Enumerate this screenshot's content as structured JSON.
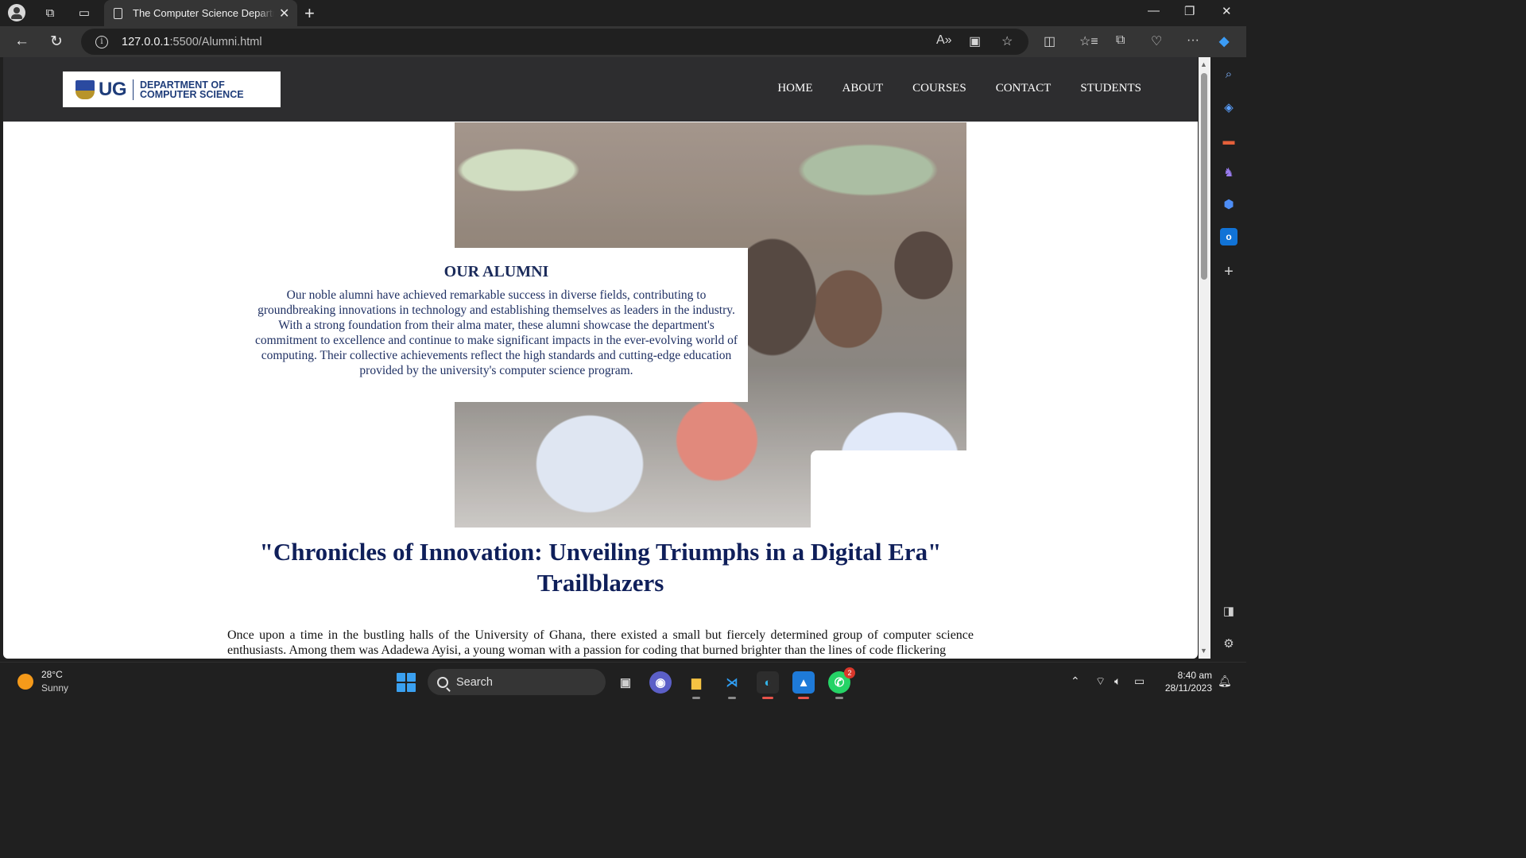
{
  "browser": {
    "tab_title": "The Computer Science Departme",
    "url_host": "127.0.0.1",
    "url_path": ":5500/Alumni.html",
    "new_tab": "+",
    "tab_close": "✕"
  },
  "site": {
    "logo": {
      "ug": "UG",
      "dept_line1": "DEPARTMENT OF",
      "dept_line2": "COMPUTER SCIENCE"
    },
    "nav": [
      "HOME",
      "ABOUT",
      "COURSES",
      "CONTACT",
      "STUDENTS"
    ],
    "alumni": {
      "title": "OUR ALUMNI",
      "text": "Our noble alumni have achieved remarkable success in diverse fields, contributing to groundbreaking innovations in technology and establishing themselves as leaders in the industry. With a strong foundation from their alma mater, these alumni showcase the department's commitment to excellence and continue to make significant impacts in the ever-evolving world of computing. Their collective achievements reflect the high standards and cutting-edge education provided by the university's computer science program."
    },
    "heading_line1": "\"Chronicles of Innovation: Unveiling Triumphs in a Digital Era\"",
    "heading_line2": "Trailblazers",
    "story": "Once upon a time in the bustling halls of the University of Ghana, there existed a small but fiercely determined group of computer science enthusiasts. Among them was Adadewa Ayisi, a young woman with a passion for coding that burned brighter than the lines of code flickering"
  },
  "taskbar": {
    "weather_temp": "28°C",
    "weather_desc": "Sunny",
    "search_placeholder": "Search",
    "whatsapp_badge": "2",
    "time": "8:40 am",
    "date": "28/11/2023"
  },
  "colors": {
    "header_bg": "#2d2d2f",
    "brand_navy": "#1f3d7a",
    "heading_navy": "#0f1f5a",
    "browser_chrome": "#202020"
  }
}
